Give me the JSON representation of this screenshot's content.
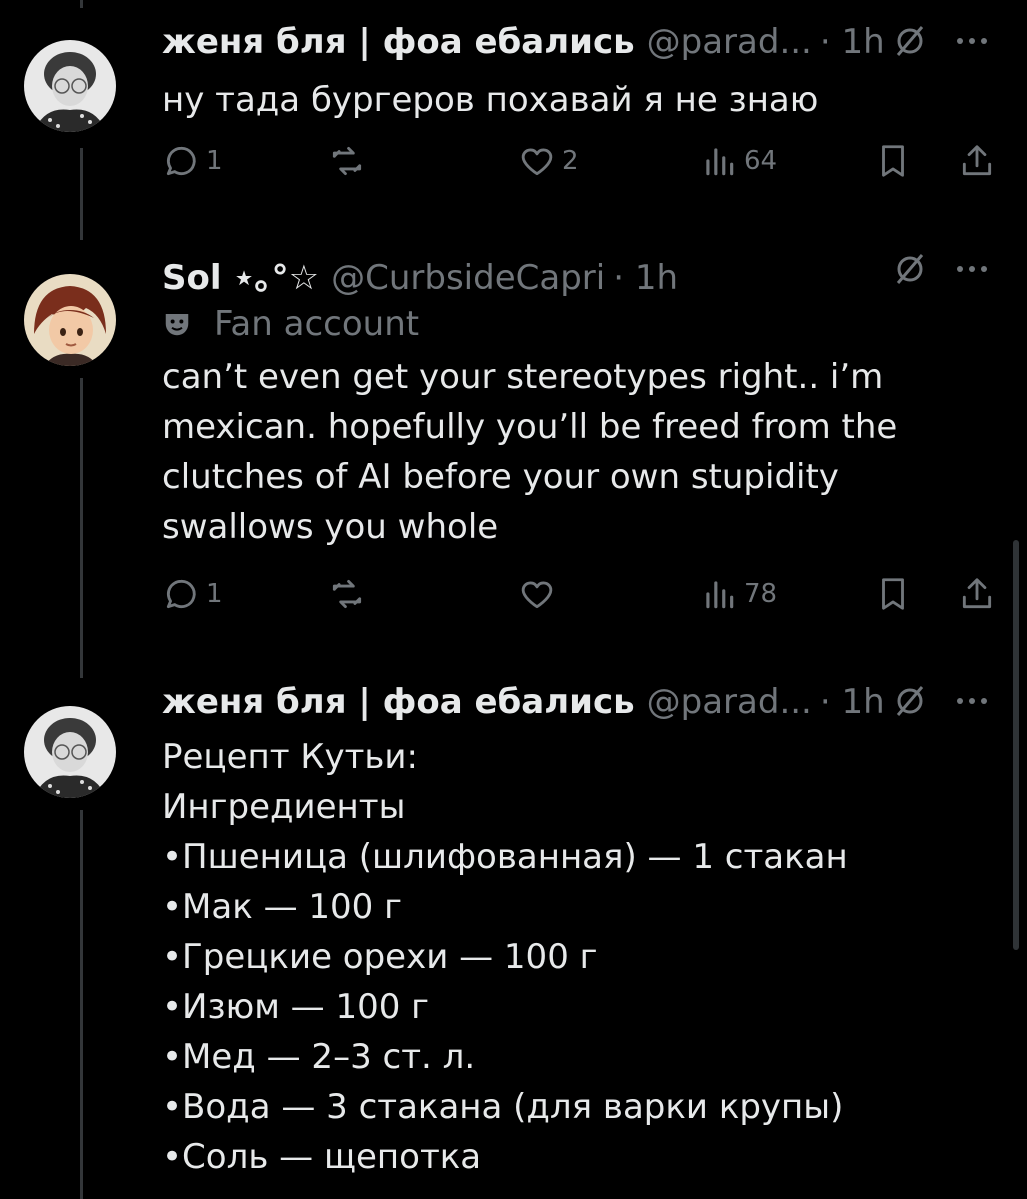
{
  "tweets": [
    {
      "display_name": "женя бля | фоа ебались",
      "handle": "@parad...",
      "time": "· 1h",
      "lines": [
        "ну тада бургеров похавай я не знаю"
      ],
      "actions": {
        "replies": "1",
        "reposts": "",
        "likes": "2",
        "views": "64"
      }
    },
    {
      "display_name": "Sol ⋆｡°☆",
      "handle": "@CurbsideCapri",
      "time": "· 1h",
      "badge": "Fan account",
      "lines": [
        "can’t even get your stereotypes right.. i’m",
        "mexican. hopefully you’ll be freed from the",
        "clutches of AI before your own stupidity",
        "swallows you whole"
      ],
      "actions": {
        "replies": "1",
        "reposts": "",
        "likes": "",
        "views": "78"
      }
    },
    {
      "display_name": "женя бля | фоа ебались",
      "handle": "@parad...",
      "time": "· 1h",
      "lines": [
        "Рецепт Кутьи:",
        "Ингредиенты",
        "•Пшеница (шлифованная) — 1 стакан",
        "•Мак — 100 г",
        "•Грецкие орехи — 100 г",
        "•Изюм — 100 г",
        "•Мед — 2–3 ст. л.",
        "•Вода — 3 стакана (для варки крупы)",
        "•Соль — щепотка"
      ]
    }
  ],
  "colors": {
    "background": "#000000",
    "text": "#e7e9ea",
    "muted": "#71767b",
    "line": "#333639"
  }
}
